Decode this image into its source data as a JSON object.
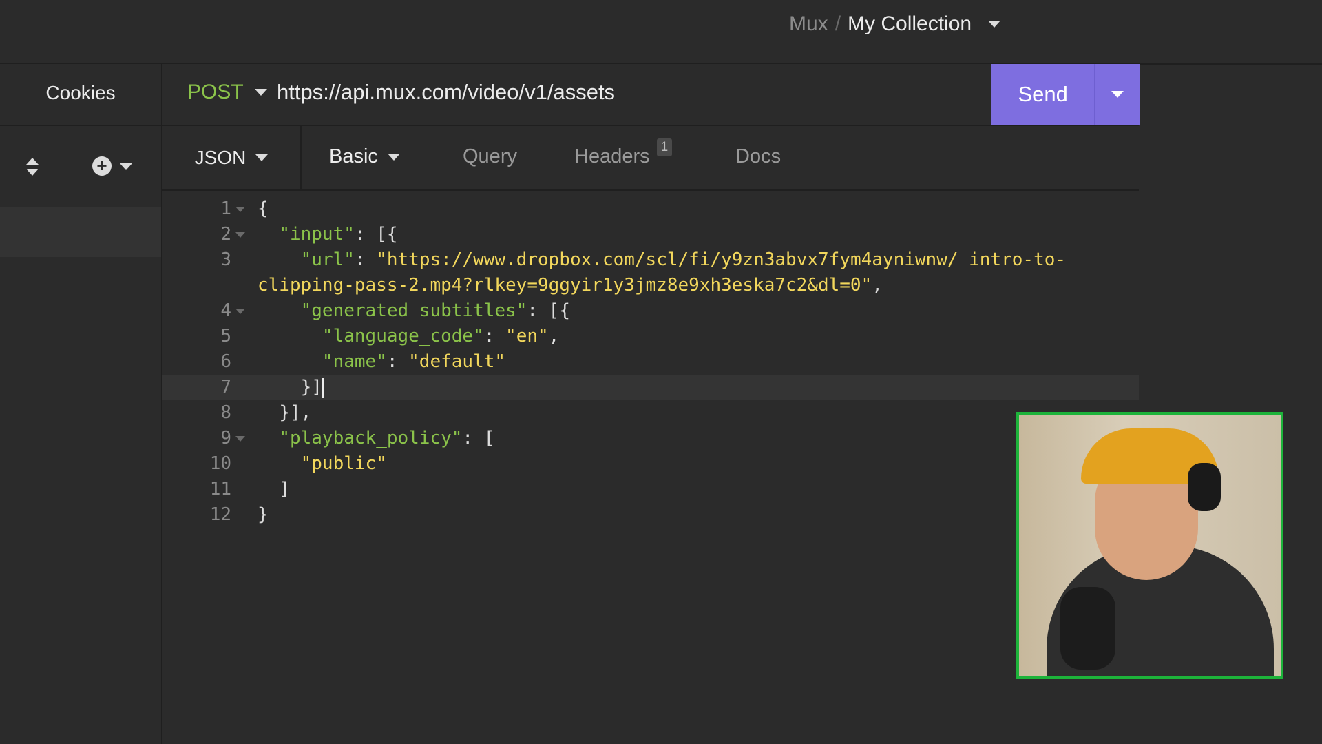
{
  "breadcrumb": {
    "parent": "Mux",
    "separator": "/",
    "current": "My Collection"
  },
  "sidebar": {
    "cookies_label": "Cookies"
  },
  "request": {
    "method": "POST",
    "url": "https://api.mux.com/video/v1/assets",
    "send_label": "Send"
  },
  "tabs": {
    "body_type": "JSON",
    "auth": "Basic",
    "query": "Query",
    "headers": "Headers",
    "headers_count": "1",
    "docs": "Docs"
  },
  "editor": {
    "lines": [
      {
        "n": "1",
        "fold": true,
        "indent": "",
        "parts": [
          [
            "p",
            "{"
          ]
        ]
      },
      {
        "n": "2",
        "fold": true,
        "indent": "  ",
        "parts": [
          [
            "k",
            "\"input\""
          ],
          [
            "p",
            ": [{"
          ]
        ]
      },
      {
        "n": "3",
        "fold": false,
        "indent": "    ",
        "parts": [
          [
            "k",
            "\"url\""
          ],
          [
            "p",
            ": "
          ],
          [
            "s",
            "\"https://www.dropbox.com/scl/fi/y9zn3abvx7fym4ayniwnw/_intro-to-"
          ]
        ]
      },
      {
        "n": "",
        "fold": false,
        "indent": "",
        "parts": [
          [
            "s",
            "clipping-pass-2.mp4?rlkey=9ggyir1y3jmz8e9xh3eska7c2&dl=0\""
          ],
          [
            "p",
            ","
          ]
        ]
      },
      {
        "n": "4",
        "fold": true,
        "indent": "    ",
        "parts": [
          [
            "k",
            "\"generated_subtitles\""
          ],
          [
            "p",
            ": [{"
          ]
        ]
      },
      {
        "n": "5",
        "fold": false,
        "indent": "      ",
        "parts": [
          [
            "k",
            "\"language_code\""
          ],
          [
            "p",
            ": "
          ],
          [
            "s",
            "\"en\""
          ],
          [
            "p",
            ","
          ]
        ]
      },
      {
        "n": "6",
        "fold": false,
        "indent": "      ",
        "parts": [
          [
            "k",
            "\"name\""
          ],
          [
            "p",
            ": "
          ],
          [
            "s",
            "\"default\""
          ]
        ]
      },
      {
        "n": "7",
        "fold": false,
        "indent": "    ",
        "parts": [
          [
            "p",
            "}]"
          ]
        ],
        "current": true
      },
      {
        "n": "8",
        "fold": false,
        "indent": "  ",
        "parts": [
          [
            "p",
            "}],"
          ]
        ]
      },
      {
        "n": "9",
        "fold": true,
        "indent": "  ",
        "parts": [
          [
            "k",
            "\"playback_policy\""
          ],
          [
            "p",
            ": ["
          ]
        ]
      },
      {
        "n": "10",
        "fold": false,
        "indent": "    ",
        "parts": [
          [
            "s",
            "\"public\""
          ]
        ]
      },
      {
        "n": "11",
        "fold": false,
        "indent": "  ",
        "parts": [
          [
            "p",
            "]"
          ]
        ]
      },
      {
        "n": "12",
        "fold": false,
        "indent": "",
        "parts": [
          [
            "p",
            "}"
          ]
        ]
      }
    ]
  },
  "colors": {
    "accent": "#7e6ee0",
    "method": "#8bc34a",
    "string": "#f2d75c",
    "webcam_border": "#1db33a"
  }
}
